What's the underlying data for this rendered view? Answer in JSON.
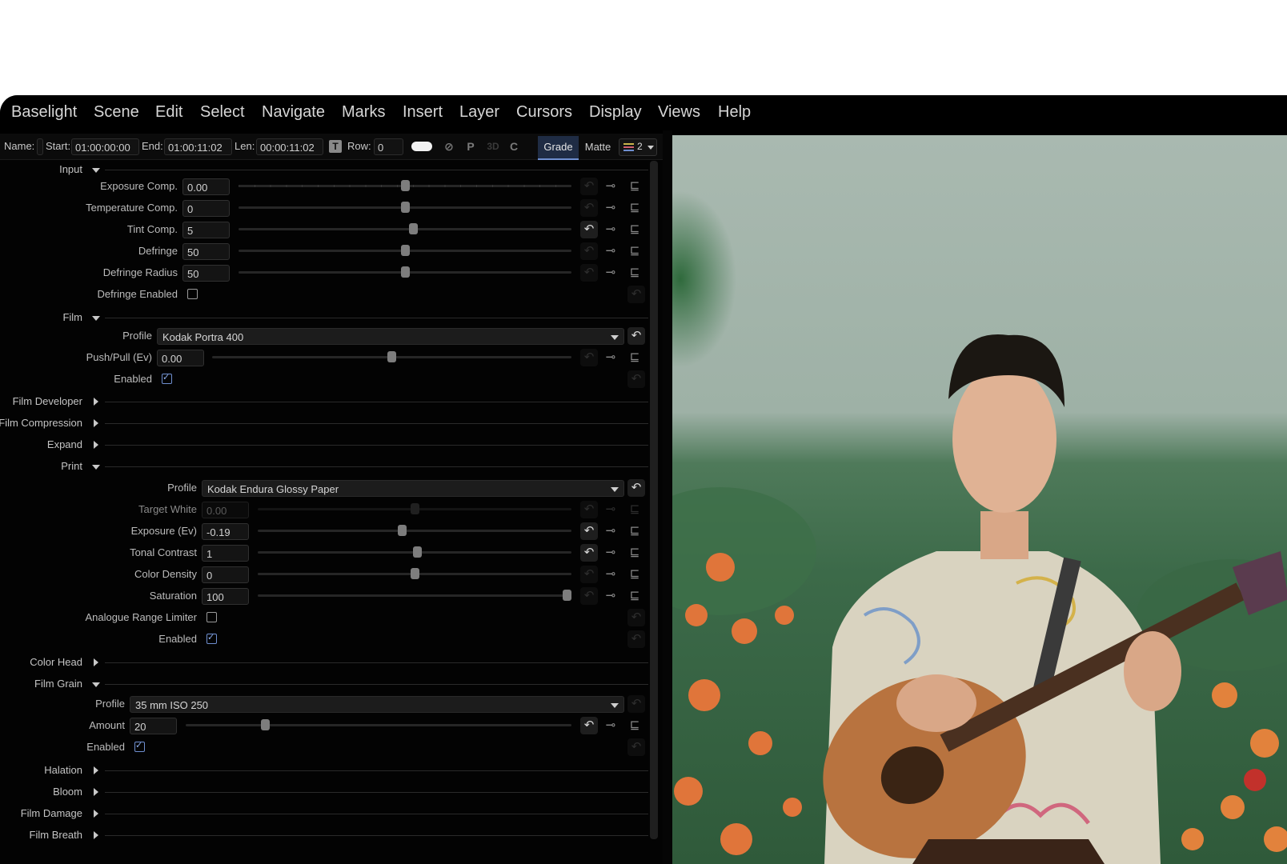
{
  "menu": [
    "Baselight",
    "Scene",
    "Edit",
    "Select",
    "Navigate",
    "Marks",
    "Insert",
    "Layer",
    "Cursors",
    "Display",
    "Views",
    "Help"
  ],
  "toolbar": {
    "name_label": "Name:",
    "name_value": "",
    "start_label": "Start:",
    "start_value": "01:00:00:00",
    "end_label": "End:",
    "end_value": "01:00:11:02",
    "len_label": "Len:",
    "len_value": "00:00:11:02",
    "row_label": "Row:",
    "row_value": "0",
    "p_label": "P",
    "three_d_label": "3D",
    "c_label": "C",
    "tab_grade": "Grade",
    "tab_matte": "Matte",
    "layers_count": "2"
  },
  "sections": {
    "input": "Input",
    "film": "Film",
    "film_developer": "Film Developer",
    "film_compression": "Film Compression",
    "expand": "Expand",
    "print": "Print",
    "color_head": "Color Head",
    "film_grain": "Film Grain",
    "halation": "Halation",
    "bloom": "Bloom",
    "film_damage": "Film Damage",
    "film_breath": "Film Breath"
  },
  "input": {
    "exposure_comp": {
      "label": "Exposure Comp.",
      "value": "0.00",
      "level": 0.5
    },
    "temperature_comp": {
      "label": "Temperature Comp.",
      "value": "0",
      "level": 0.5
    },
    "tint_comp": {
      "label": "Tint Comp.",
      "value": "5",
      "level": 0.525
    },
    "defringe": {
      "label": "Defringe",
      "value": "50",
      "level": 0.5
    },
    "defringe_radius": {
      "label": "Defringe Radius",
      "value": "50",
      "level": 0.5
    },
    "defringe_enabled": {
      "label": "Defringe Enabled",
      "checked": false
    }
  },
  "film": {
    "profile_label": "Profile",
    "profile_value": "Kodak Portra 400",
    "push_pull": {
      "label": "Push/Pull (Ev)",
      "value": "0.00",
      "level": 0.5
    },
    "enabled": {
      "label": "Enabled",
      "checked": true
    }
  },
  "print": {
    "profile_label": "Profile",
    "profile_value": "Kodak Endura Glossy Paper",
    "target_white": {
      "label": "Target White",
      "value": "0.00",
      "level": 0.5
    },
    "exposure": {
      "label": "Exposure (Ev)",
      "value": "-0.19",
      "level": 0.46
    },
    "tonal_contrast": {
      "label": "Tonal Contrast",
      "value": "1",
      "level": 0.51
    },
    "color_density": {
      "label": "Color Density",
      "value": "0",
      "level": 0.5
    },
    "saturation": {
      "label": "Saturation",
      "value": "100",
      "level": 1.0
    },
    "analogue_range_limiter": {
      "label": "Analogue Range Limiter",
      "checked": false
    },
    "enabled": {
      "label": "Enabled",
      "checked": true
    }
  },
  "film_grain": {
    "profile_label": "Profile",
    "profile_value": "35 mm ISO 250",
    "amount": {
      "label": "Amount",
      "value": "20",
      "level": 0.2
    },
    "enabled": {
      "label": "Enabled",
      "checked": true
    }
  },
  "colors": {
    "accent": "#6f8fd0",
    "panel_bg": "#030303",
    "menu_text": "#d6d6d6"
  }
}
